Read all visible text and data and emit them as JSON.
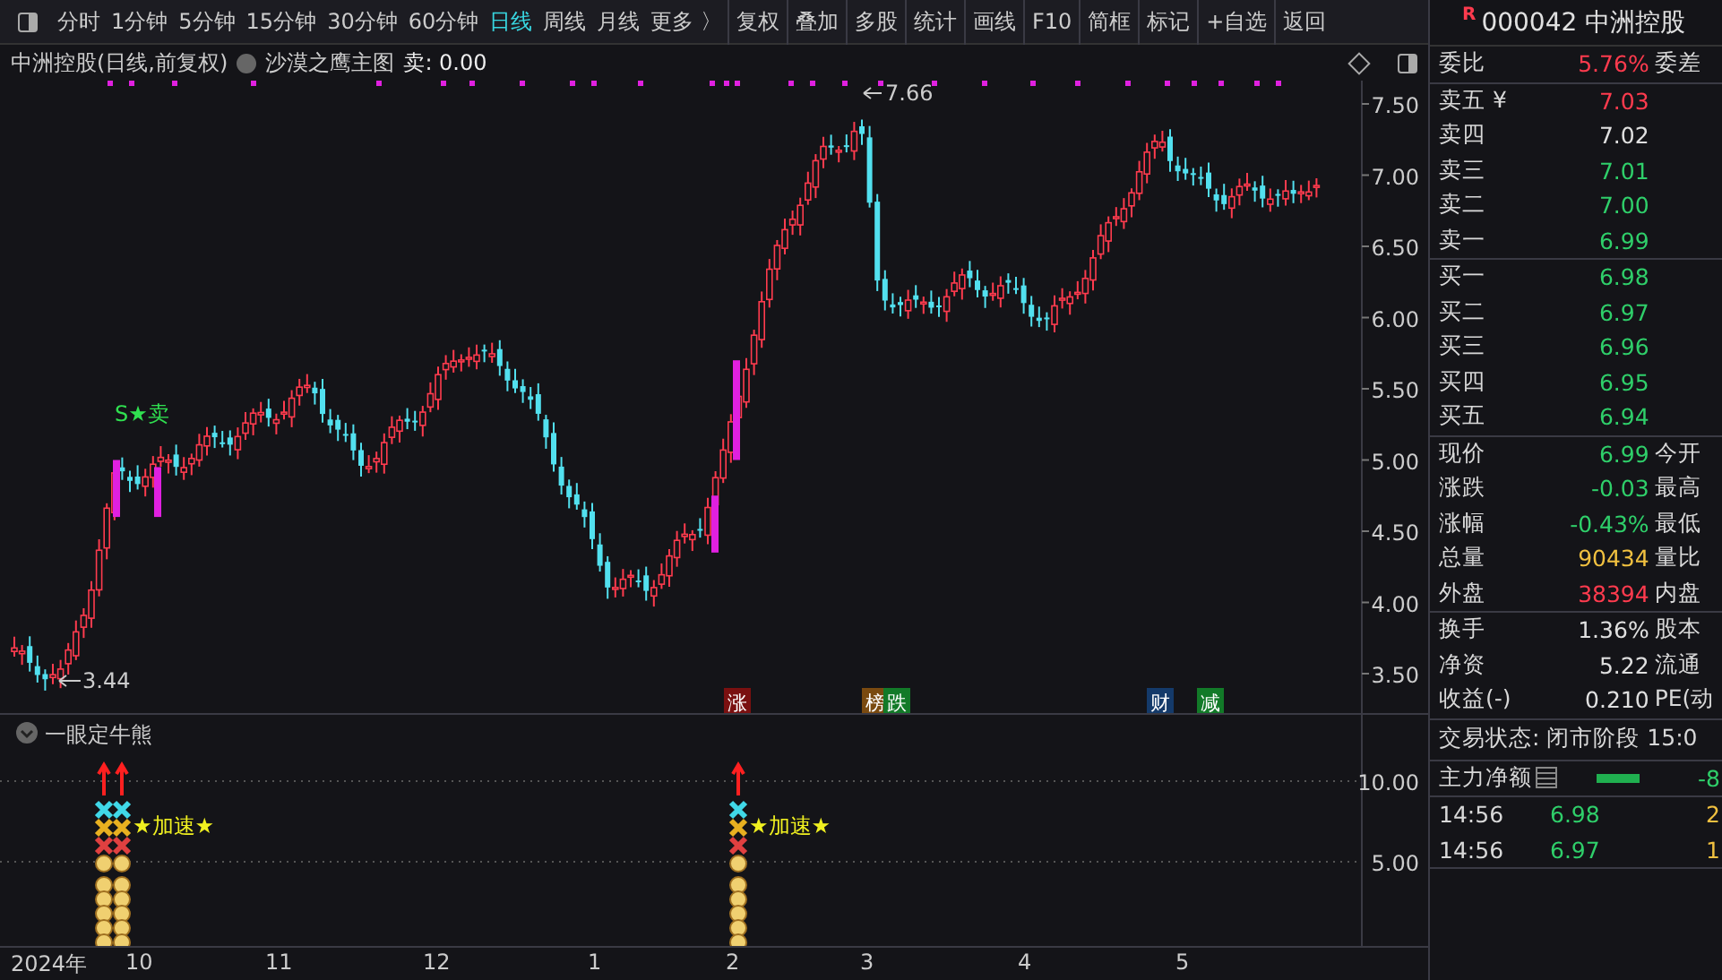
{
  "toolbar": {
    "periods": [
      {
        "label": "分时",
        "selected": false
      },
      {
        "label": "1分钟",
        "selected": false
      },
      {
        "label": "5分钟",
        "selected": false
      },
      {
        "label": "15分钟",
        "selected": false
      },
      {
        "label": "30分钟",
        "selected": false
      },
      {
        "label": "60分钟",
        "selected": false
      },
      {
        "label": "日线",
        "selected": true
      },
      {
        "label": "周线",
        "selected": false
      },
      {
        "label": "月线",
        "selected": false
      },
      {
        "label": "更多 〉",
        "selected": false
      }
    ],
    "buttons": [
      "复权",
      "叠加",
      "多股",
      "统计",
      "画线",
      "F10",
      "简框",
      "标记",
      "+自选",
      "返回"
    ]
  },
  "chart": {
    "title": "中洲控股(日线,前复权)",
    "indicator": "沙漠之鹰主图",
    "reading": "卖: 0.00",
    "yticks": [
      "7.50",
      "7.00",
      "6.50",
      "6.00",
      "5.50",
      "5.00",
      "4.50",
      "4.00",
      "3.50"
    ],
    "high_label": "7.66",
    "low_label": "3.44",
    "signal": "S★卖",
    "tags": [
      {
        "text": "涨",
        "color": "#7a1010"
      },
      {
        "text": "榜",
        "color": "#7a4a10"
      },
      {
        "text": "跌",
        "color": "#127a28"
      },
      {
        "text": "财",
        "color": "#143a6a"
      },
      {
        "text": "减",
        "color": "#127a28"
      }
    ]
  },
  "sub_chart": {
    "title": "一眼定牛熊",
    "yticks": [
      "10.00",
      "5.00"
    ],
    "labels": [
      "★加速★",
      "★加速★"
    ]
  },
  "dates": [
    "2024年",
    "10",
    "11",
    "12",
    "1",
    "2",
    "3",
    "4",
    "5"
  ],
  "quote": {
    "badge": "R",
    "code": "000042 中洲控股",
    "ratio": {
      "label": "委比",
      "value": "5.76%",
      "label2": "委差"
    },
    "asks": [
      {
        "label": "卖五 ¥",
        "price": "7.03",
        "color": "#ff3b4e"
      },
      {
        "label": "卖四",
        "price": "7.02",
        "color": "#e0e0e0"
      },
      {
        "label": "卖三",
        "price": "7.01",
        "color": "#2fcf6a"
      },
      {
        "label": "卖二",
        "price": "7.00",
        "color": "#2fcf6a"
      },
      {
        "label": "卖一",
        "price": "6.99",
        "color": "#2fcf6a"
      }
    ],
    "bids": [
      {
        "label": "买一",
        "price": "6.98",
        "color": "#2fcf6a"
      },
      {
        "label": "买二",
        "price": "6.97",
        "color": "#2fcf6a"
      },
      {
        "label": "买三",
        "price": "6.96",
        "color": "#2fcf6a"
      },
      {
        "label": "买四",
        "price": "6.95",
        "color": "#2fcf6a"
      },
      {
        "label": "买五",
        "price": "6.94",
        "color": "#2fcf6a"
      }
    ],
    "stats": [
      {
        "label": "现价",
        "value": "6.99",
        "color": "#2fcf6a",
        "label2": "今开"
      },
      {
        "label": "涨跌",
        "value": "-0.03",
        "color": "#2fcf6a",
        "label2": "最高"
      },
      {
        "label": "涨幅",
        "value": "-0.43%",
        "color": "#2fcf6a",
        "label2": "最低"
      },
      {
        "label": "总量",
        "value": "90434",
        "color": "#f0c040",
        "label2": "量比"
      },
      {
        "label": "外盘",
        "value": "38394",
        "color": "#ff3b4e",
        "label2": "内盘"
      }
    ],
    "stats2": [
      {
        "label": "换手",
        "value": "1.36%",
        "color": "#e0e0e0",
        "label2": "股本"
      },
      {
        "label": "净资",
        "value": "5.22",
        "color": "#e0e0e0",
        "label2": "流通"
      },
      {
        "label": "收益(-)",
        "value": "0.210",
        "color": "#e0e0e0",
        "label2": "PE(动"
      }
    ],
    "status": "交易状态: 闭市阶段 15:0",
    "net": {
      "label": "主力净额",
      "value": "-8"
    },
    "ticks": [
      {
        "time": "14:56",
        "price": "6.98",
        "color": "#2fcf6a",
        "volume": "2"
      },
      {
        "time": "14:56",
        "price": "6.97",
        "color": "#2fcf6a",
        "volume": "1"
      }
    ]
  }
}
